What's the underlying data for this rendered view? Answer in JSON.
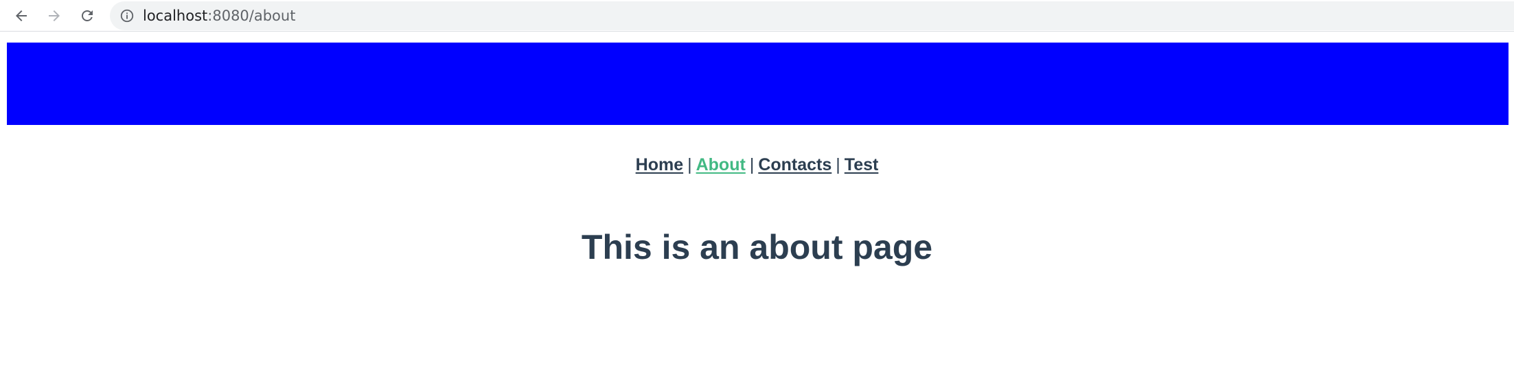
{
  "browser": {
    "url_host": "localhost",
    "url_path": ":8080/about",
    "icons": {
      "back": "arrow-left-icon",
      "forward": "arrow-right-icon",
      "reload": "reload-icon",
      "info": "info-icon"
    }
  },
  "header": {
    "banner_color": "#0000ff"
  },
  "nav": {
    "home_label": "Home",
    "about_label": "About",
    "contacts_label": "Contacts",
    "test_label": "Test",
    "separator": "|",
    "active": "About",
    "active_color": "#42b983",
    "link_color": "#2c3e50"
  },
  "main": {
    "heading": "This is an about page"
  }
}
